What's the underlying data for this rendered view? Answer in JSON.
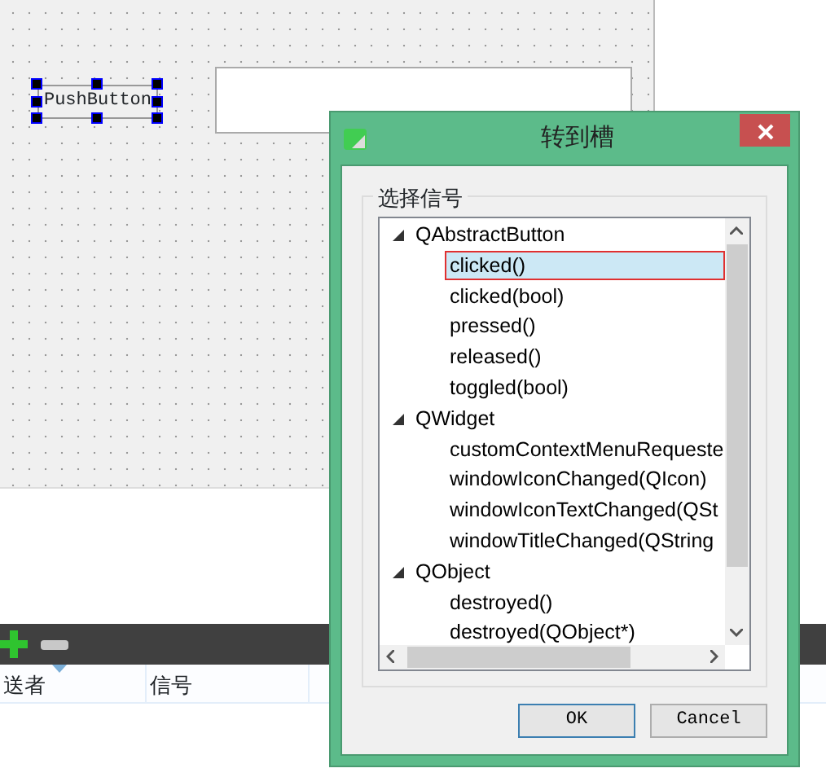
{
  "form": {
    "widgets": [
      {
        "kind": "push-button",
        "label": "PushButton",
        "selected": true
      },
      {
        "kind": "line-edit"
      }
    ]
  },
  "signal_slot_editor": {
    "columns": [
      {
        "label": "送者",
        "sort_indicator": true
      },
      {
        "label": "信号",
        "sort_indicator": false
      }
    ]
  },
  "dialog": {
    "title": "转到槽",
    "group_title": "选择信号",
    "tree": [
      {
        "label": "QAbstractButton",
        "expanded": true,
        "children": [
          {
            "label": "clicked()",
            "selected": true
          },
          {
            "label": "clicked(bool)",
            "selected": false
          },
          {
            "label": "pressed()",
            "selected": false
          },
          {
            "label": "released()",
            "selected": false
          },
          {
            "label": "toggled(bool)",
            "selected": false
          }
        ]
      },
      {
        "label": "QWidget",
        "expanded": true,
        "children": [
          {
            "label": "customContextMenuRequeste",
            "selected": false
          },
          {
            "label": "windowIconChanged(QIcon)",
            "selected": false
          },
          {
            "label": "windowIconTextChanged(QSt",
            "selected": false
          },
          {
            "label": "windowTitleChanged(QString",
            "selected": false
          }
        ]
      },
      {
        "label": "QObject",
        "expanded": true,
        "children": [
          {
            "label": "destroyed()",
            "selected": false
          },
          {
            "label": "destroyed(QObject*)",
            "selected": false
          }
        ]
      }
    ],
    "buttons": [
      {
        "label": "OK",
        "default": true
      },
      {
        "label": "Cancel",
        "default": false
      }
    ]
  }
}
